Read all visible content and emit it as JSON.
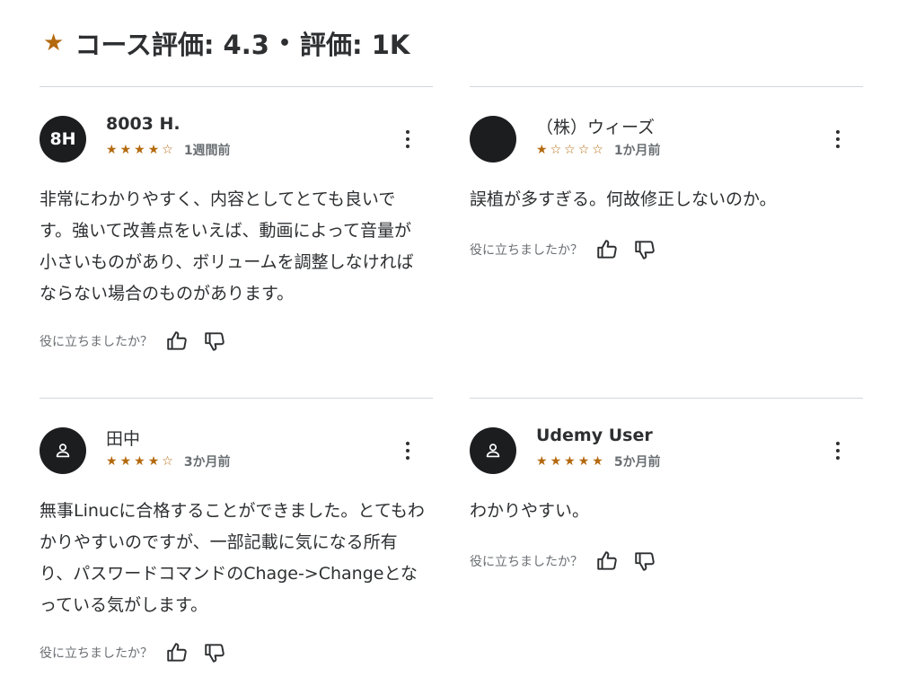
{
  "header": {
    "rating_text": "コース評価: 4.3",
    "separator": "•",
    "count_text": "評価: 1K"
  },
  "helpful_label": "役に立ちましたか？",
  "colors": {
    "star": "#b4690e",
    "avatar_bg": "#1c1d1f",
    "divider": "#d1d7dc"
  },
  "reviews": [
    {
      "avatar_initials": "8H",
      "name": "8003 H.",
      "rating": 4,
      "stars": [
        "★",
        "★",
        "★",
        "★",
        "☆"
      ],
      "date": "1週間前",
      "text": "非常にわかりやすく、内容としてとても良いです。強いて改善点をいえば、動画によって音量が小さいものがあり、ボリュームを調整しなければならない場合のものがあります。"
    },
    {
      "avatar_initials": "",
      "name": "（株）ウィーズ",
      "rating": 1,
      "stars": [
        "★",
        "☆",
        "☆",
        "☆",
        "☆"
      ],
      "date": "1か月前",
      "text": "誤植が多すぎる。何故修正しないのか。"
    },
    {
      "avatar_icon": "user-icon",
      "name": "田中",
      "rating": 4,
      "stars": [
        "★",
        "★",
        "★",
        "★",
        "☆"
      ],
      "date": "3か月前",
      "text": "無事Linucに合格することができました。とてもわかりやすいのですが、一部記載に気になる所有り、パスワードコマンドのChage->Changeとなっている気がします。"
    },
    {
      "avatar_icon": "user-icon",
      "name": "Udemy User",
      "rating": 5,
      "stars": [
        "★",
        "★",
        "★",
        "★",
        "★"
      ],
      "date": "5か月前",
      "text": "わかりやすい。"
    }
  ]
}
